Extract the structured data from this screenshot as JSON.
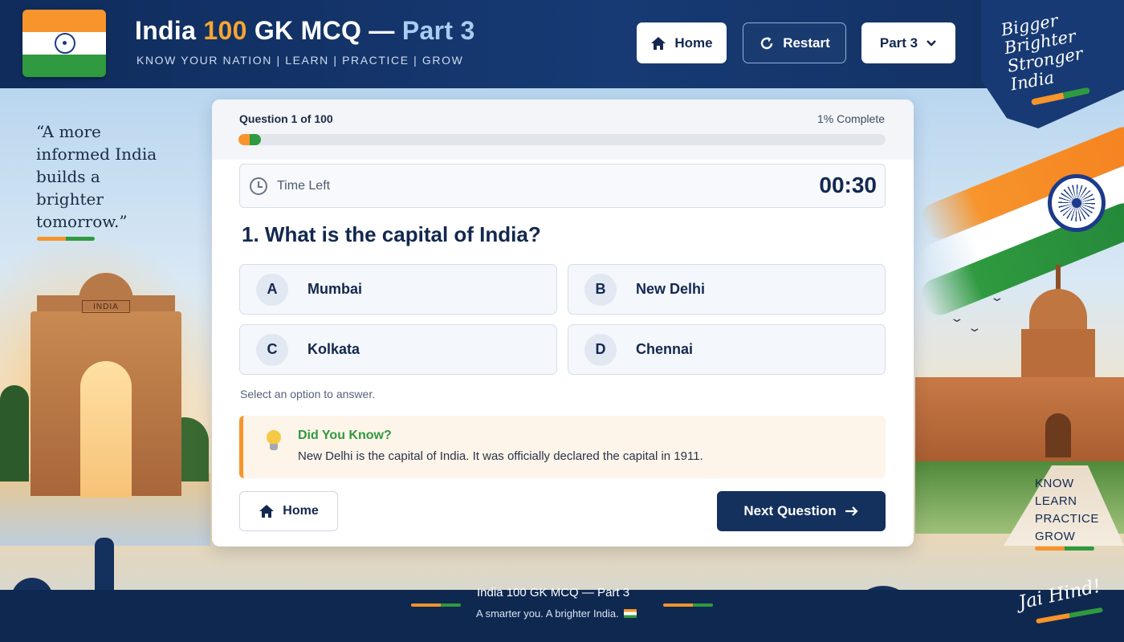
{
  "header": {
    "title_main": "India ",
    "title_number": "100",
    "title_rest": " GK MCQ — ",
    "title_part": "Part 3",
    "tagline": "KNOW YOUR NATION  |  LEARN  |  PRACTICE  |  GROW",
    "home_label": "Home",
    "restart_label": "Restart",
    "part_select_label": "Part 3",
    "slogan": [
      "Bigger",
      "Brighter",
      "Stronger",
      "India"
    ]
  },
  "left_panel": {
    "quote_lines": [
      "“A more",
      "informed India",
      "builds a",
      "brighter",
      "tomorrow.”"
    ],
    "monument_label": "INDIA"
  },
  "right_panel": {
    "words": [
      "KNOW",
      "LEARN",
      "PRACTICE",
      "GROW"
    ]
  },
  "quiz": {
    "counter": "Question 1 of 100",
    "percent_label": "1% Complete",
    "progress_fraction": 0.01,
    "timer_label": "Time Left",
    "timer_value": "00:30",
    "question": "1.  What is the capital of India?",
    "options": [
      {
        "letter": "A",
        "text": "Mumbai"
      },
      {
        "letter": "B",
        "text": "New Delhi"
      },
      {
        "letter": "C",
        "text": "Kolkata"
      },
      {
        "letter": "D",
        "text": "Chennai"
      }
    ],
    "hint": "Select an option to answer.",
    "did_you_know_title": "Did You Know?",
    "did_you_know_text": "New Delhi is the capital of India. It was officially declared the capital in 1911.",
    "home_label": "Home",
    "next_label": "Next Question"
  },
  "footer": {
    "title": "India 100 GK MCQ — Part 3",
    "subtitle": "A smarter you. A brighter India.",
    "sign_off": "Jai Hind!"
  },
  "colors": {
    "navy": "#13284f",
    "saffron": "#f7942b",
    "green": "#2f9a3f"
  }
}
